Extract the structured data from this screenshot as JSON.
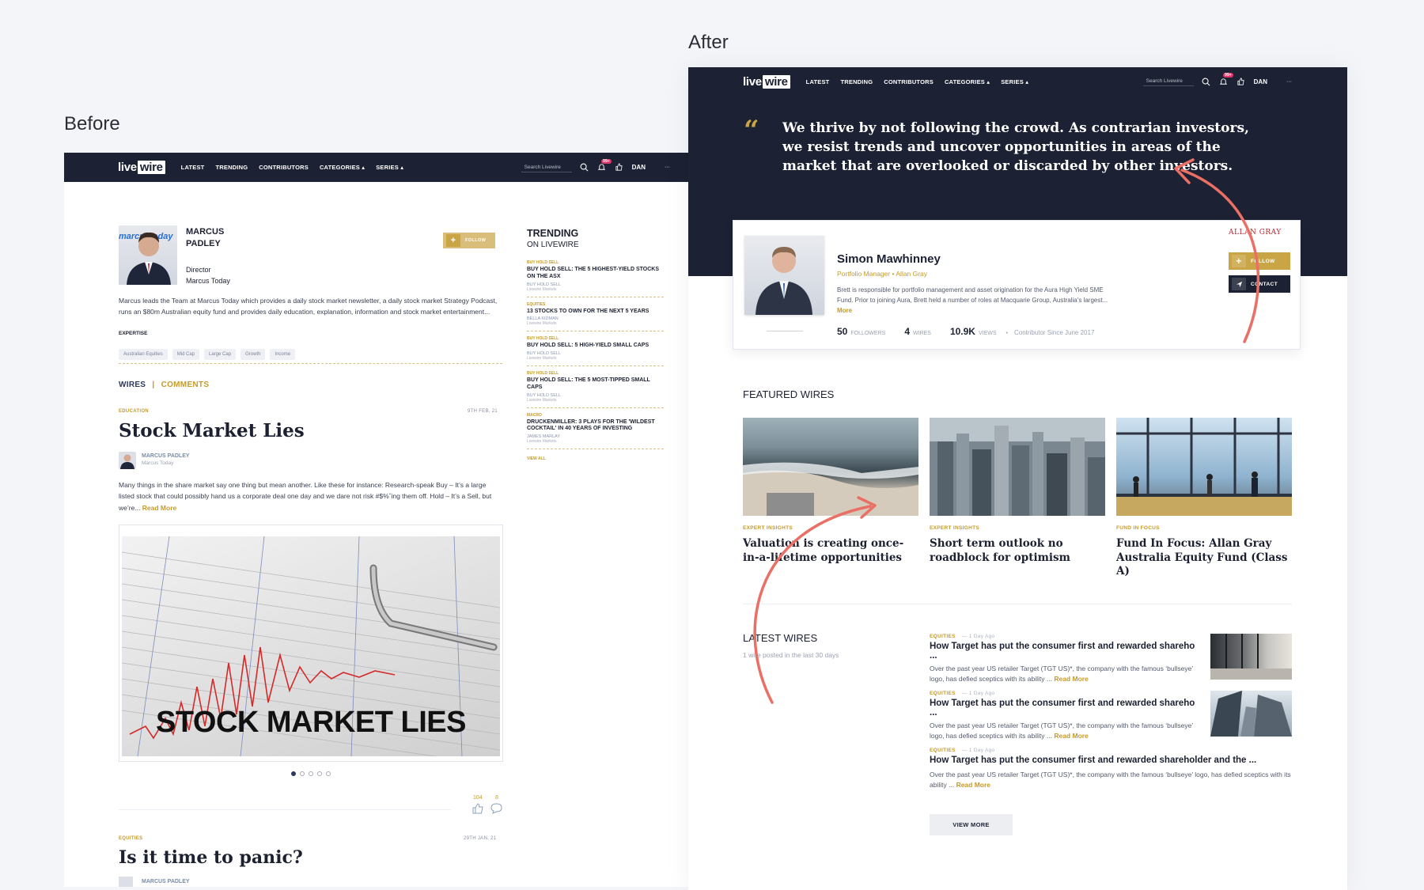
{
  "captions": {
    "before": "Before",
    "after": "After"
  },
  "nav": {
    "logo_a": "live",
    "logo_b": "wire",
    "links": [
      "LATEST",
      "TRENDING",
      "CONTRIBUTORS",
      "CATEGORIES",
      "SERIES"
    ],
    "search_placeholder": "Search Livewire",
    "notif_count": "99+",
    "user": "DAN",
    "more": "···"
  },
  "before": {
    "author": {
      "first": "MARCUS",
      "last": "PADLEY",
      "role": "Director",
      "company": "Marcus Today",
      "logo_text": "marcustoday",
      "follow": "FOLLOW",
      "bio": "Marcus leads the Team at Marcus Today which provides a daily stock market newsletter, a daily stock market Strategy Podcast, runs an $80m Australian equity fund and provides daily education, explanation, information and stock market entertainment...",
      "expertise_label": "EXPERTISE",
      "tags": [
        "Australian Equities",
        "Mid Cap",
        "Large Cap",
        "Growth",
        "Income"
      ]
    },
    "tabs": {
      "wires": "WIRES",
      "sep": "|",
      "comments": "COMMENTS"
    },
    "article1": {
      "category": "EDUCATION",
      "date": "9TH FEB, 21",
      "title": "Stock Market Lies",
      "author": "MARCUS PADLEY",
      "org": "Marcus Today",
      "excerpt": "Many things in the share market say one thing but mean another. Like these for instance: Research-speak Buy – It’s a large listed stock that could possibly hand us a corporate deal one day and we dare not risk #$%ˆing them off. Hold – It’s a Sell, but we’re...",
      "read_more": "Read More",
      "image_text": "STOCK MARKET LIES",
      "likes": "104",
      "comments": "8"
    },
    "article2": {
      "category": "EQUITIES",
      "date": "29TH JAN, 21",
      "title": "Is it time to panic?",
      "author": "MARCUS PADLEY"
    },
    "trending": {
      "title": "TRENDING",
      "subtitle": "ON LIVEWIRE",
      "items": [
        {
          "cat": "BUY HOLD SELL",
          "title": "BUY HOLD SELL: THE 5 HIGHEST-YIELD STOCKS ON THE ASX",
          "author": "BUY HOLD SELL",
          "org": "Livewire Markets"
        },
        {
          "cat": "EQUITIES",
          "title": "13 STOCKS TO OWN FOR THE NEXT 5 YEARS",
          "author": "BELLA KIDMAN",
          "org": "Livewire Markets"
        },
        {
          "cat": "BUY HOLD SELL",
          "title": "BUY HOLD SELL: 5 HIGH-YIELD SMALL CAPS",
          "author": "BUY HOLD SELL",
          "org": "Livewire Markets"
        },
        {
          "cat": "BUY HOLD SELL",
          "title": "BUY HOLD SELL: THE 5 MOST-TIPPED SMALL CAPS",
          "author": "BUY HOLD SELL",
          "org": "Livewire Markets"
        },
        {
          "cat": "MACRO",
          "title": "DRUCKENMILLER: 3 PLAYS FOR THE 'WILDEST COCKTAIL' IN 40 YEARS OF INVESTING",
          "author": "JAMES MARLAY",
          "org": "Livewire Markets"
        }
      ],
      "view_all": "VIEW ALL"
    }
  },
  "after": {
    "quote": "We thrive by not following the crowd. As contrarian investors, we resist trends and uncover opportunities in areas of the market that are overlooked or discarded by other investors.",
    "profile": {
      "name": "Simon Mawhinney",
      "role": "Portfolio Manager",
      "company": "Allan Gray",
      "bio": "Brett is responsible for portfolio management and asset origination for the Aura High Yield SME Fund. Prior to joining Aura, Brett held a number of roles at Macquarie Group, Australia’s largest...",
      "more": "More",
      "followers": "50",
      "followers_label": "FOLLOWERS",
      "wires": "4",
      "wires_label": "WIRES",
      "views": "10.9K",
      "views_label": "VIEWS",
      "since": "Contributor Since June 2017",
      "brand": "ALLAN GRAY",
      "follow": "FOLLOW",
      "contact": "CONTACT"
    },
    "featured": {
      "title": "FEATURED WIRES",
      "items": [
        {
          "cat": "EXPERT INSIGHTS",
          "title": "Valuation is creating once-in-a-lifetime opportunities"
        },
        {
          "cat": "EXPERT INSIGHTS",
          "title": "Short term outlook no roadblock for optimism"
        },
        {
          "cat": "FUND IN FOCUS",
          "title": "Fund In Focus: Allan Gray Australia Equity Fund (Class A)"
        }
      ]
    },
    "latest": {
      "title": "LATEST WIRES",
      "subtitle": "1 wire posted in the last 30 days",
      "items": [
        {
          "cat": "EQUITIES",
          "age": "1 Day Ago",
          "title": "How Target has put the consumer first and rewarded shareho ...",
          "body": "Over the past year US retailer Target (TGT US)*, the company with the famous ‘bullseye’ logo, has defied sceptics with its ability ...",
          "read": "Read More"
        },
        {
          "cat": "EQUITIES",
          "age": "1 Day Ago",
          "title": "How Target has put the consumer first and rewarded shareho ...",
          "body": "Over the past year US retailer Target (TGT US)*, the company with the famous ‘bullseye’ logo, has defied sceptics with its ability ...",
          "read": "Read More"
        },
        {
          "cat": "EQUITIES",
          "age": "1 Day Ago",
          "title": "How Target has put the consumer first and rewarded shareholder and the ...",
          "body": "Over the past year US retailer Target (TGT US)*, the company with the famous ‘bullseye’ logo, has defied sceptics with its ability ...",
          "read": "Read More"
        }
      ],
      "view_more": "VIEW MORE"
    }
  }
}
